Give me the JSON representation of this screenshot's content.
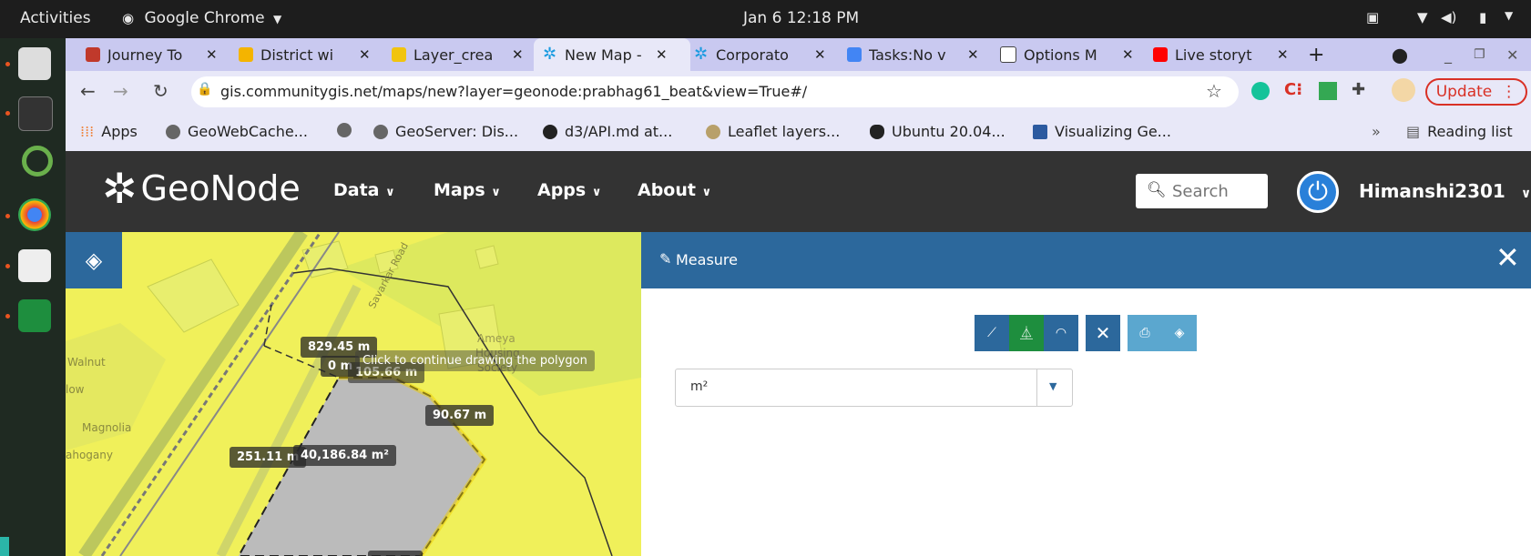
{
  "os": {
    "activities": "Activities",
    "app_name": "Google Chrome",
    "clock": "Jan 6  12:18 PM"
  },
  "browser": {
    "tabs": [
      {
        "label": "Journey To",
        "color": "#c0392b"
      },
      {
        "label": "District wi",
        "color": "#f4b400"
      },
      {
        "label": "Layer_crea",
        "color": "#f1c40f"
      },
      {
        "label": "New Map -",
        "color": "#1a9be0"
      },
      {
        "label": "Corporato",
        "color": "#1a9be0"
      },
      {
        "label": "Tasks:No v",
        "color": "#4285f4"
      },
      {
        "label": "Options M",
        "color": "#444444"
      },
      {
        "label": "Live storyt",
        "color": "#ff0000"
      }
    ],
    "new_tab": "+",
    "url": "gis.communitygis.net/maps/new?layer=geonode:prabhag61_beat&view=True#/",
    "update_label": "Update",
    "bookmarks": [
      "Apps",
      "GeoWebCache...",
      "GeoServer: Dis...",
      "d3/API.md at...",
      "Leaflet layers...",
      "Ubuntu 20.04...",
      "Visualizing Ge..."
    ],
    "bookmarks_overflow": "»",
    "reading_list": "Reading list"
  },
  "geonode": {
    "logo": "GeoNode",
    "menu": [
      "Data",
      "Maps",
      "Apps",
      "About"
    ],
    "search_placeholder": "Search",
    "username": "Himanshi2301"
  },
  "measure": {
    "title": "Measure",
    "unit": "m²"
  },
  "map": {
    "place_labels": [
      "Walnut",
      "low",
      "Magnolia",
      "ahogany",
      "Ameya",
      "Housing",
      "Society",
      "Savarkar Road"
    ],
    "measure_labels": [
      "829.45 m",
      "0 m",
      "105.66 m",
      "90.67 m",
      "251.11 m",
      "40,186.84 m²"
    ],
    "tooltip": "Click to continue drawing the polygon"
  },
  "colors": {
    "header_bg": "#333333",
    "panel_header": "#2c689c",
    "map_fill": "#f0f05a"
  }
}
